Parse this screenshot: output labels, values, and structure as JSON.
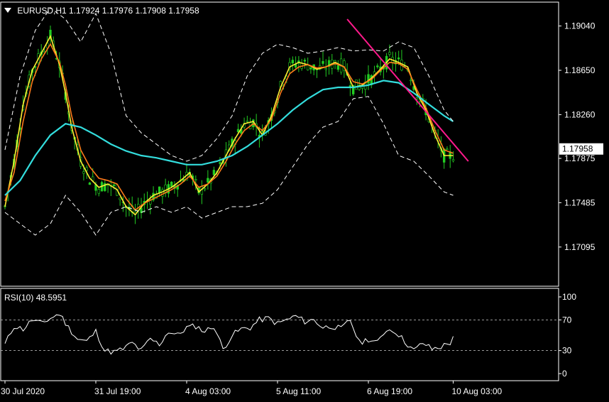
{
  "header": {
    "symbol": "EURUSD,H1",
    "open": "1.17924",
    "high": "1.17976",
    "low": "1.17908",
    "close": "1.17958"
  },
  "rsi_header": {
    "label": "RSI(10)",
    "value": "48.5951"
  },
  "colors": {
    "background": "#000000",
    "candles": "#22cc22",
    "ma_fast": "#ffee33",
    "ma_mid": "#ff7a1a",
    "ma_slow": "#33dddd",
    "bands": "#ffffff",
    "trendline": "#ff1a8c",
    "price_tag_bg": "#ffffff",
    "price_tag_text": "#000000"
  },
  "chart_data": [
    {
      "type": "line",
      "panel": "price",
      "xlabel": "",
      "ylabel": "",
      "ylim": [
        1.1675,
        1.1925
      ],
      "yticks": [
        "1.19040",
        "1.18650",
        "1.18260",
        "1.17875",
        "1.17485",
        "1.17095"
      ],
      "current_price": "1.17958",
      "x_tick_labels": [
        "30 Jul 2020",
        "31 Jul 19:00",
        "4 Aug 03:00",
        "5 Aug 11:00",
        "6 Aug 19:00",
        "10 Aug 03:00"
      ],
      "x_index_range": [
        0,
        150
      ],
      "x_tick_index": [
        0,
        30,
        60,
        90,
        120,
        148
      ],
      "grid": false,
      "series": [
        {
          "x": [
            0,
            3,
            6,
            9,
            12,
            15,
            18,
            20,
            22,
            25,
            28,
            31,
            34,
            37,
            40,
            43,
            46,
            49,
            52,
            55,
            58,
            61,
            64,
            67,
            70,
            73,
            76,
            79,
            82,
            85,
            88,
            91,
            94,
            97,
            100,
            103,
            106,
            109,
            112,
            115,
            118,
            121,
            124,
            127,
            130,
            133,
            136,
            139,
            142,
            145,
            148
          ],
          "values": [
            1.1745,
            1.1785,
            1.1835,
            1.1865,
            1.188,
            1.1895,
            1.187,
            1.1845,
            1.1815,
            1.1785,
            1.177,
            1.1762,
            1.1765,
            1.176,
            1.1745,
            1.1738,
            1.1748,
            1.1755,
            1.1758,
            1.1762,
            1.1768,
            1.1775,
            1.1758,
            1.1765,
            1.1775,
            1.179,
            1.1805,
            1.1818,
            1.182,
            1.1808,
            1.1825,
            1.185,
            1.1868,
            1.1872,
            1.187,
            1.1866,
            1.1868,
            1.1872,
            1.1868,
            1.185,
            1.1852,
            1.1858,
            1.1866,
            1.1875,
            1.1872,
            1.1868,
            1.1845,
            1.183,
            1.1808,
            1.179,
            1.179
          ]
        },
        {
          "x": [
            0,
            3,
            6,
            9,
            12,
            15,
            18,
            20,
            22,
            25,
            28,
            31,
            34,
            37,
            40,
            43,
            46,
            49,
            52,
            55,
            58,
            61,
            64,
            67,
            70,
            73,
            76,
            79,
            82,
            85,
            88,
            91,
            94,
            97,
            100,
            103,
            106,
            109,
            112,
            115,
            118,
            121,
            124,
            127,
            130,
            133,
            136,
            139,
            142,
            145,
            148
          ],
          "values": [
            1.175,
            1.1775,
            1.182,
            1.1855,
            1.1875,
            1.1888,
            1.1872,
            1.1852,
            1.1825,
            1.1795,
            1.178,
            1.177,
            1.1768,
            1.1765,
            1.1752,
            1.1742,
            1.1748,
            1.1752,
            1.1756,
            1.176,
            1.1765,
            1.1772,
            1.1762,
            1.1765,
            1.1772,
            1.1785,
            1.18,
            1.1812,
            1.1818,
            1.1812,
            1.1822,
            1.1845,
            1.1862,
            1.1868,
            1.187,
            1.1867,
            1.1868,
            1.1871,
            1.1868,
            1.1855,
            1.1853,
            1.1857,
            1.1865,
            1.1872,
            1.1871,
            1.1866,
            1.1848,
            1.1832,
            1.1812,
            1.1795,
            1.1792
          ]
        },
        {
          "x": [
            0,
            5,
            10,
            15,
            20,
            25,
            30,
            35,
            40,
            45,
            50,
            55,
            60,
            65,
            70,
            75,
            80,
            85,
            90,
            95,
            100,
            105,
            110,
            115,
            120,
            125,
            130,
            135,
            140,
            145,
            148
          ],
          "values": [
            1.1755,
            1.1768,
            1.179,
            1.1808,
            1.1818,
            1.1815,
            1.1808,
            1.18,
            1.1794,
            1.179,
            1.1788,
            1.1785,
            1.1782,
            1.1782,
            1.1785,
            1.179,
            1.1798,
            1.1808,
            1.1818,
            1.183,
            1.184,
            1.1848,
            1.185,
            1.185,
            1.1852,
            1.1856,
            1.1854,
            1.1845,
            1.1835,
            1.1825,
            1.182
          ]
        },
        {
          "x": [
            0,
            5,
            10,
            15,
            20,
            25,
            30,
            35,
            40,
            45,
            50,
            55,
            60,
            65,
            70,
            75,
            80,
            85,
            90,
            95,
            100,
            105,
            110,
            115,
            120,
            125,
            130,
            135,
            140,
            145,
            148
          ],
          "values": [
            1.1795,
            1.186,
            1.19,
            1.192,
            1.191,
            1.189,
            1.1915,
            1.188,
            1.1825,
            1.181,
            1.18,
            1.179,
            1.1785,
            1.179,
            1.1805,
            1.1825,
            1.186,
            1.188,
            1.1888,
            1.1885,
            1.188,
            1.1882,
            1.1885,
            1.1882,
            1.1883,
            1.1882,
            1.189,
            1.1885,
            1.186,
            1.183,
            1.182
          ]
        },
        {
          "x": [
            0,
            5,
            10,
            15,
            20,
            25,
            30,
            35,
            40,
            45,
            50,
            55,
            60,
            65,
            70,
            75,
            80,
            85,
            90,
            95,
            100,
            105,
            110,
            115,
            120,
            125,
            130,
            135,
            140,
            145,
            148
          ],
          "values": [
            1.174,
            1.173,
            1.172,
            1.173,
            1.1755,
            1.174,
            1.172,
            1.174,
            1.1745,
            1.174,
            1.1745,
            1.174,
            1.1745,
            1.1735,
            1.174,
            1.1745,
            1.1745,
            1.1748,
            1.176,
            1.178,
            1.18,
            1.1815,
            1.182,
            1.184,
            1.1842,
            1.1818,
            1.179,
            1.1785,
            1.1772,
            1.1758,
            1.1755
          ]
        }
      ],
      "trendline": {
        "x": [
          113,
          153
        ],
        "values": [
          1.191,
          1.1785
        ]
      }
    },
    {
      "type": "line",
      "panel": "rsi",
      "xlabel": "",
      "ylabel": "",
      "ylim": [
        0,
        100
      ],
      "yticks": [
        "100",
        "70",
        "30",
        "0"
      ],
      "levels": [
        70,
        30
      ],
      "series": [
        {
          "name": "RSI(10)",
          "x": [
            0,
            3,
            6,
            9,
            12,
            15,
            18,
            21,
            24,
            27,
            30,
            33,
            36,
            39,
            42,
            45,
            48,
            51,
            54,
            57,
            60,
            63,
            66,
            69,
            72,
            75,
            78,
            81,
            84,
            87,
            90,
            93,
            96,
            99,
            102,
            105,
            108,
            111,
            114,
            117,
            120,
            123,
            126,
            129,
            132,
            135,
            138,
            141,
            144,
            147,
            148
          ],
          "values": [
            38,
            62,
            58,
            70,
            65,
            72,
            78,
            60,
            45,
            42,
            55,
            30,
            28,
            32,
            40,
            30,
            45,
            38,
            55,
            50,
            60,
            62,
            55,
            62,
            32,
            50,
            58,
            60,
            70,
            72,
            65,
            70,
            75,
            68,
            70,
            60,
            62,
            58,
            70,
            40,
            45,
            40,
            58,
            55,
            42,
            30,
            40,
            32,
            35,
            40,
            48.6
          ]
        }
      ]
    }
  ]
}
